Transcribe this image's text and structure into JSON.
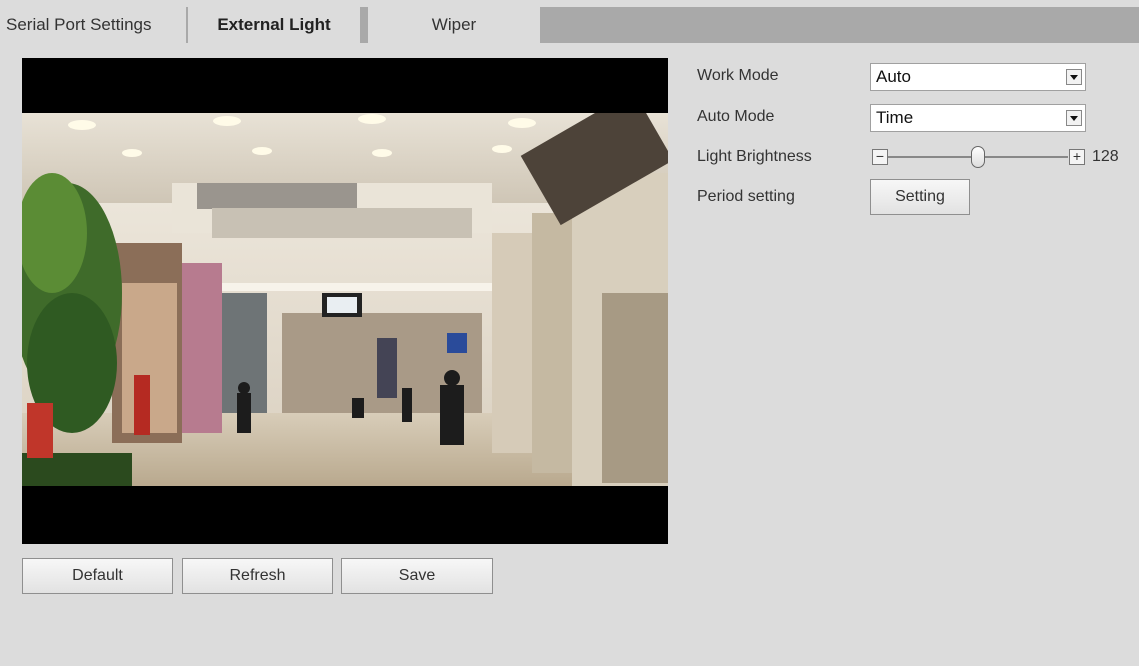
{
  "tabs": [
    {
      "label": "Serial Port Settings",
      "active": false
    },
    {
      "label": "External Light",
      "active": true
    },
    {
      "label": "Wiper",
      "active": false
    }
  ],
  "settings": {
    "work_mode": {
      "label": "Work Mode",
      "value": "Auto"
    },
    "auto_mode": {
      "label": "Auto Mode",
      "value": "Time"
    },
    "light_brightness": {
      "label": "Light Brightness",
      "value": "128",
      "fraction": 0.5
    },
    "period_setting": {
      "label": "Period setting",
      "button_label": "Setting"
    }
  },
  "actions": {
    "default_label": "Default",
    "refresh_label": "Refresh",
    "save_label": "Save"
  },
  "colors": {
    "background": "#dcdcdc",
    "tab_strip": "#a9a9a9"
  }
}
